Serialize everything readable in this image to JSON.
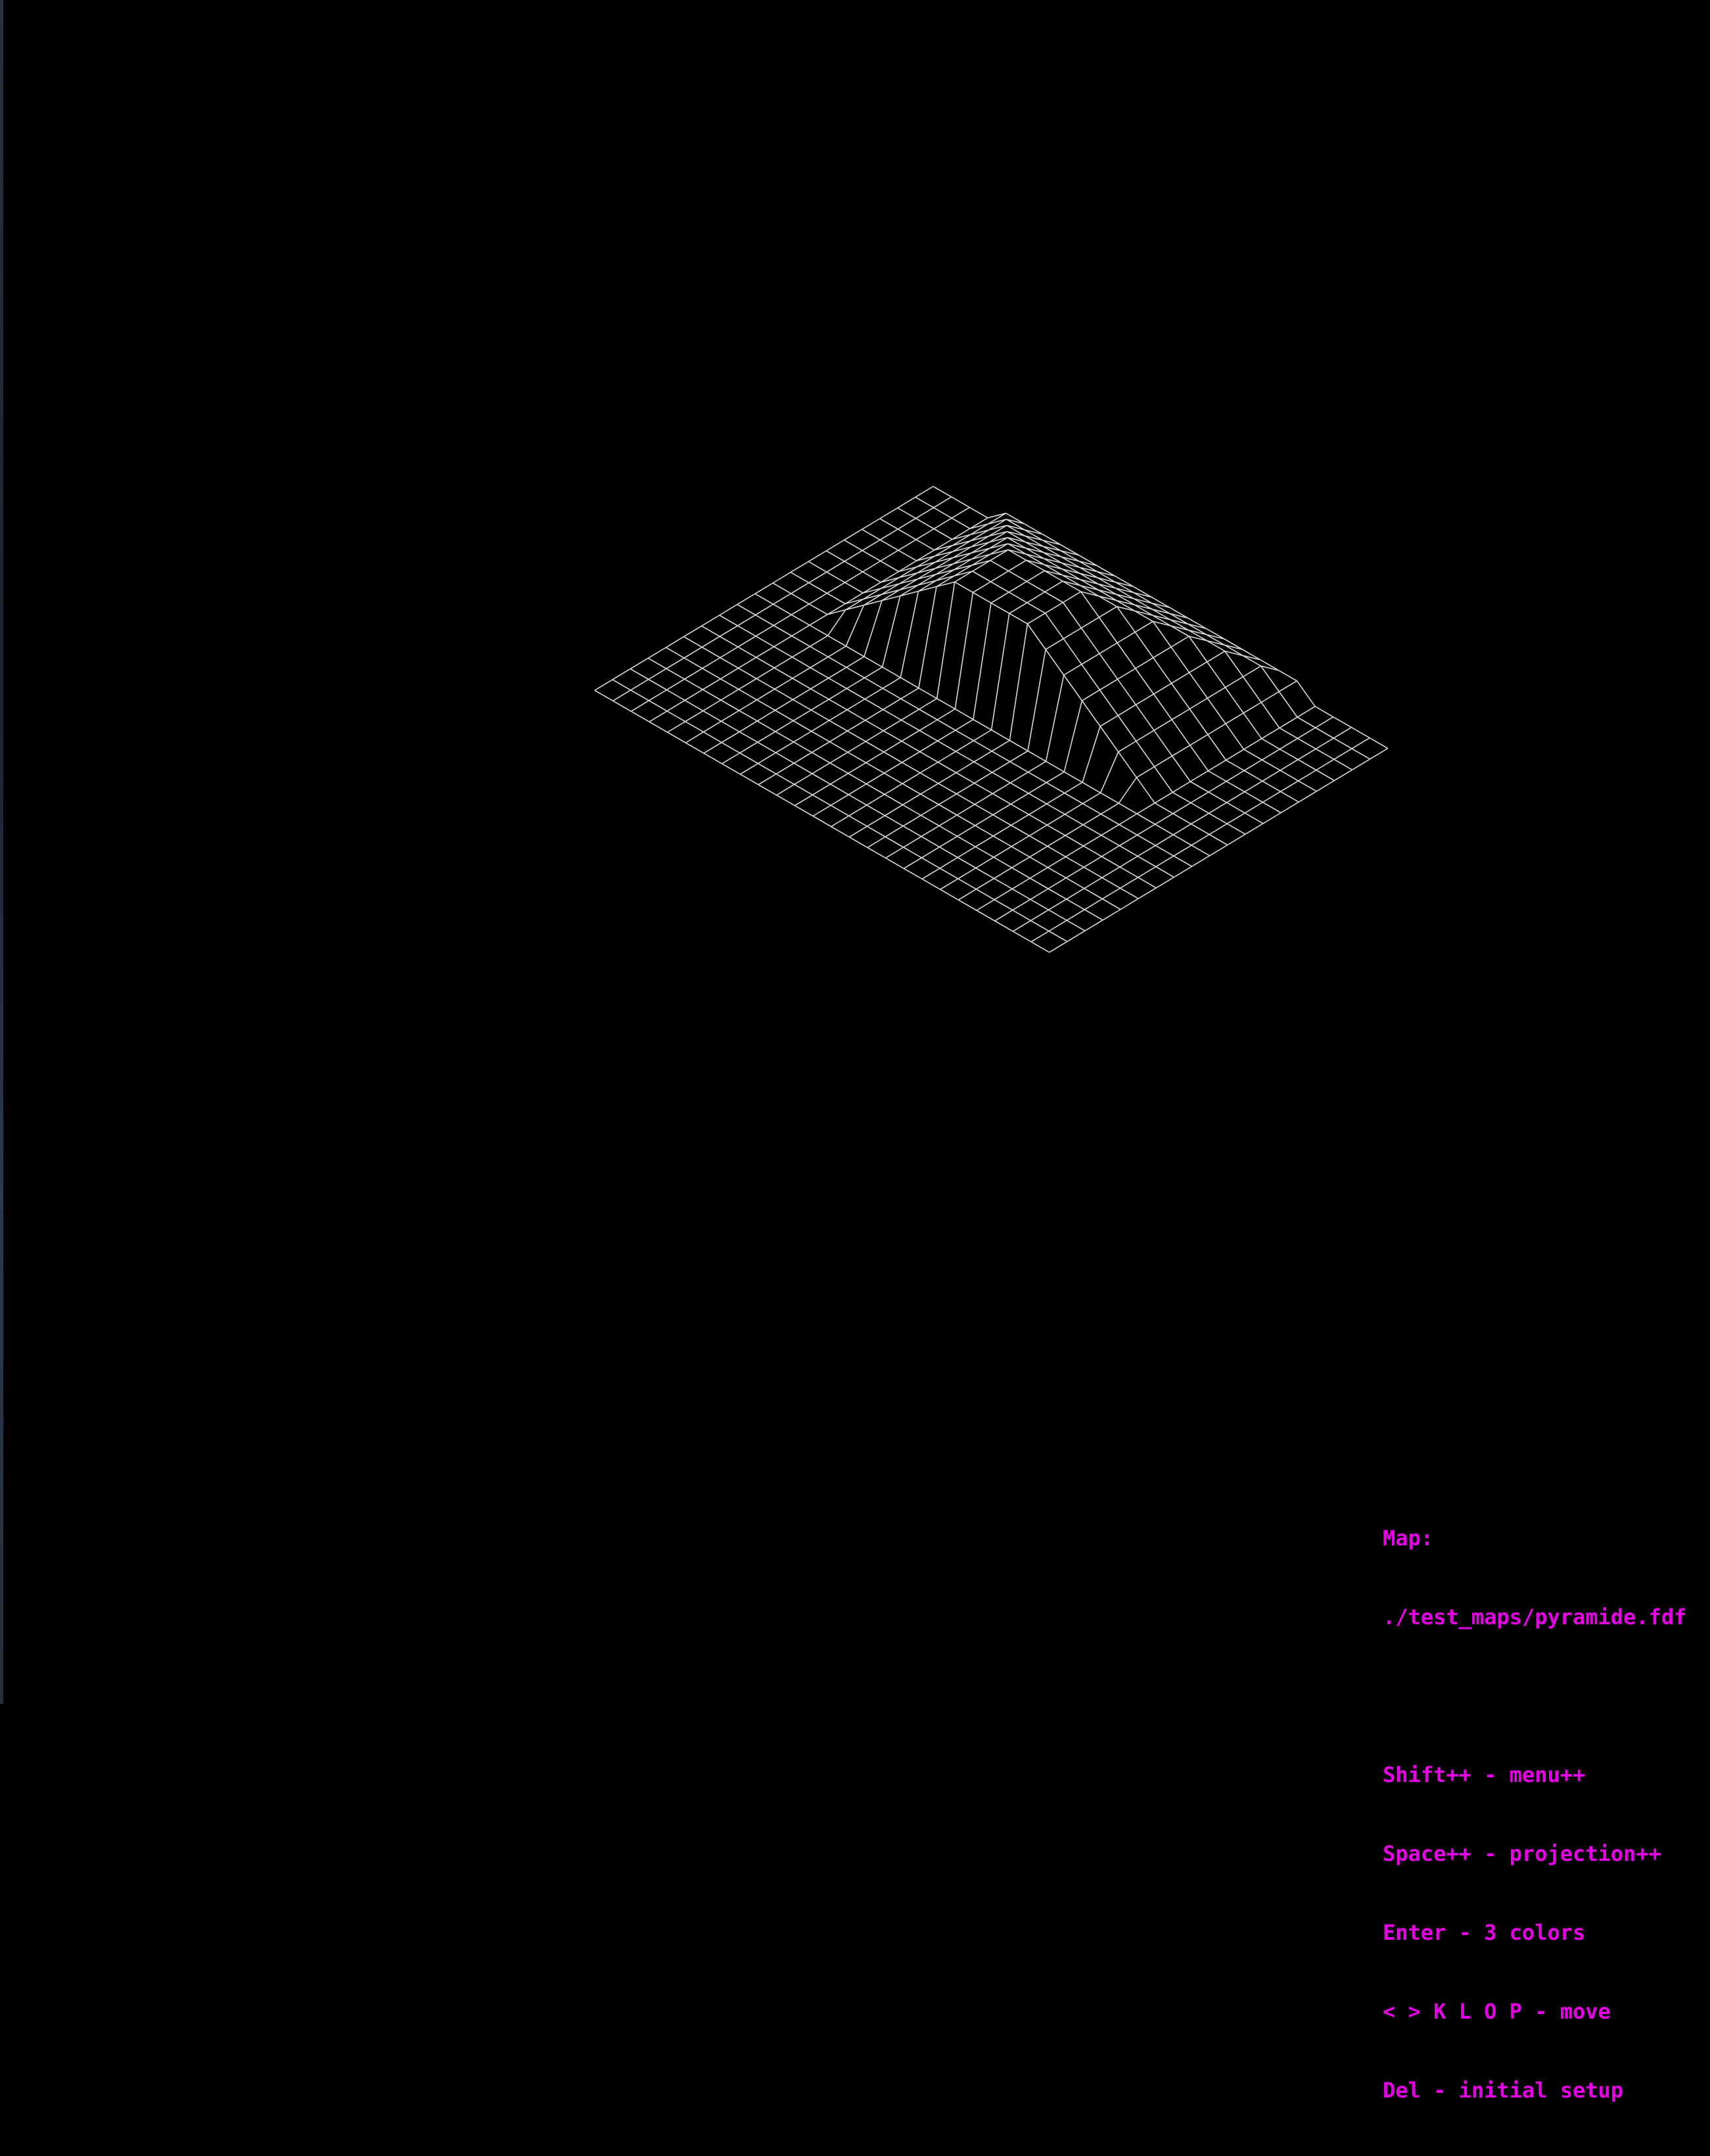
{
  "window": {
    "background_color": "#000000"
  },
  "map": {
    "label": "Map:",
    "path": "./test_maps/pyramide.fdf",
    "projection": "isometric",
    "grid_columns": 19,
    "grid_rows": 25,
    "line_color": "#d9d9d9",
    "pyramid_levels": [
      1,
      2,
      3,
      4,
      5,
      6,
      7
    ],
    "pyramid_corners": [
      [
        0,
        4
      ],
      [
        9,
        7
      ],
      [
        0,
        17
      ],
      [
        8,
        20
      ]
    ]
  },
  "menu": {
    "text_color": "#e600e6",
    "items": [
      "Shift++ - menu++",
      "Space++ - projection++",
      "Enter - 3 colors",
      "< > K L O P - move",
      "Del - initial setup"
    ]
  }
}
